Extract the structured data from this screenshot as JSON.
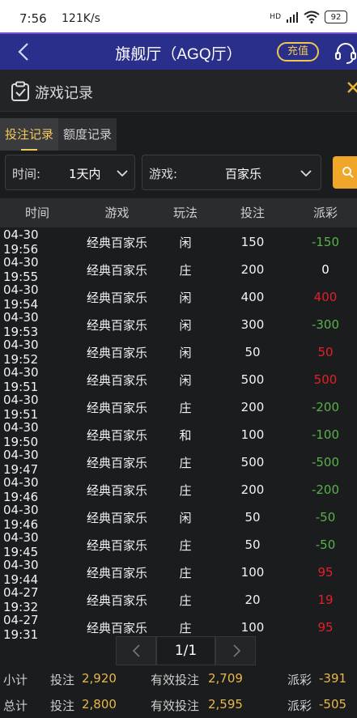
{
  "status_bar": {
    "time": "7:56",
    "speed": "121K/s",
    "network": "HD",
    "battery": "92"
  },
  "header": {
    "title": "旗舰厅（AGQ厅）",
    "recharge_label": "充值"
  },
  "panel": {
    "title": "游戏记录"
  },
  "tabs": [
    {
      "label": "投注记录",
      "active": true
    },
    {
      "label": "额度记录",
      "active": false
    }
  ],
  "filters": {
    "time_label": "时间:",
    "time_value": "1天内",
    "game_label": "游戏:",
    "game_value": "百家乐"
  },
  "table": {
    "columns": [
      "时间",
      "游戏",
      "玩法",
      "投注",
      "派彩"
    ],
    "rows": [
      {
        "time": "04-30 19:56",
        "game": "经典百家乐",
        "play": "闲",
        "bet": "150",
        "payout": "-150"
      },
      {
        "time": "04-30 19:55",
        "game": "经典百家乐",
        "play": "庄",
        "bet": "200",
        "payout": "0"
      },
      {
        "time": "04-30 19:54",
        "game": "经典百家乐",
        "play": "闲",
        "bet": "400",
        "payout": "400"
      },
      {
        "time": "04-30 19:53",
        "game": "经典百家乐",
        "play": "闲",
        "bet": "300",
        "payout": "-300"
      },
      {
        "time": "04-30 19:52",
        "game": "经典百家乐",
        "play": "闲",
        "bet": "50",
        "payout": "50"
      },
      {
        "time": "04-30 19:51",
        "game": "经典百家乐",
        "play": "闲",
        "bet": "500",
        "payout": "500"
      },
      {
        "time": "04-30 19:51",
        "game": "经典百家乐",
        "play": "庄",
        "bet": "200",
        "payout": "-200"
      },
      {
        "time": "04-30 19:50",
        "game": "经典百家乐",
        "play": "和",
        "bet": "100",
        "payout": "-100"
      },
      {
        "time": "04-30 19:47",
        "game": "经典百家乐",
        "play": "庄",
        "bet": "500",
        "payout": "-500"
      },
      {
        "time": "04-30 19:46",
        "game": "经典百家乐",
        "play": "庄",
        "bet": "200",
        "payout": "-200"
      },
      {
        "time": "04-30 19:46",
        "game": "经典百家乐",
        "play": "闲",
        "bet": "50",
        "payout": "-50"
      },
      {
        "time": "04-30 19:45",
        "game": "经典百家乐",
        "play": "庄",
        "bet": "50",
        "payout": "-50"
      },
      {
        "time": "04-30 19:44",
        "game": "经典百家乐",
        "play": "庄",
        "bet": "100",
        "payout": "95"
      },
      {
        "time": "04-27 19:32",
        "game": "经典百家乐",
        "play": "庄",
        "bet": "20",
        "payout": "19"
      },
      {
        "time": "04-27 19:31",
        "game": "经典百家乐",
        "play": "庄",
        "bet": "100",
        "payout": "95"
      }
    ]
  },
  "pagination": {
    "label": "1/1"
  },
  "subtotal": {
    "label": "小计",
    "bet_label": "投注",
    "bet": "2,920",
    "valid_label": "有效投注",
    "valid": "2,709",
    "payout_label": "派彩",
    "payout": "-391"
  },
  "total": {
    "label": "总计",
    "bet_label": "投注",
    "bet": "2,800",
    "valid_label": "有效投注",
    "valid": "2,595",
    "payout_label": "派彩",
    "payout": "-505"
  }
}
